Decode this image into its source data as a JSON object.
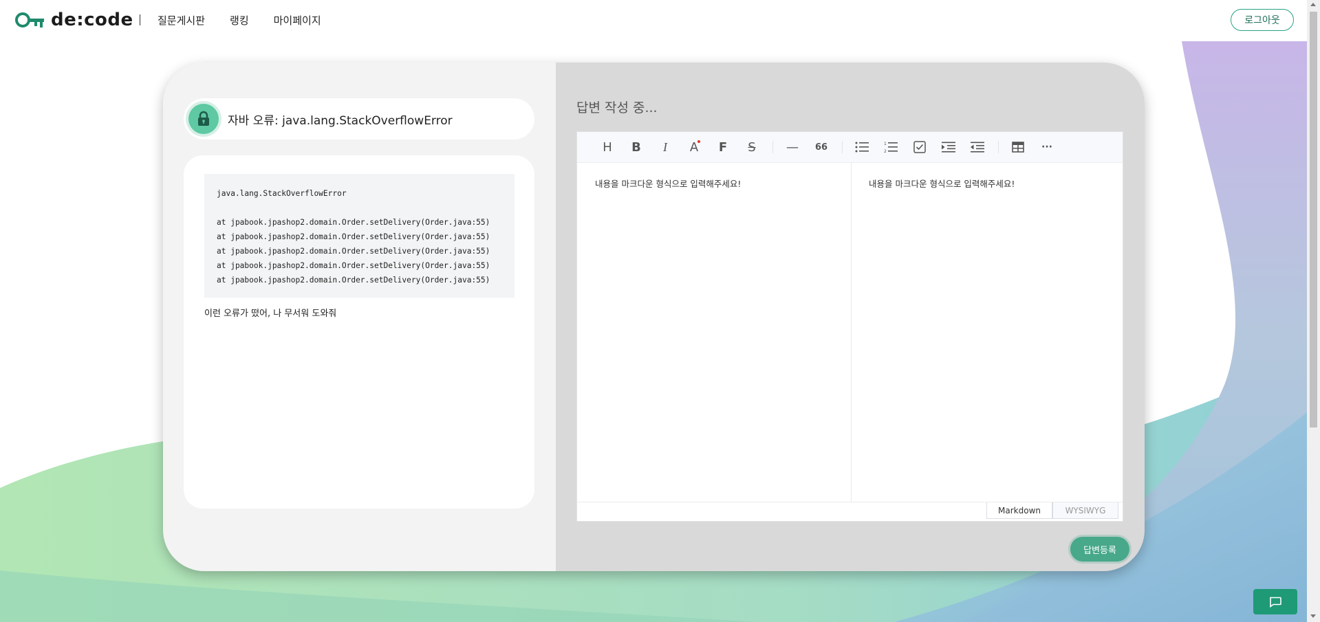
{
  "header": {
    "logo_text": "de:code",
    "nav": [
      "질문게시판",
      "랭킹",
      "마이페이지"
    ],
    "logout_label": "로그아웃"
  },
  "question": {
    "title": "자바 오류: java.lang.StackOverflowError",
    "code_lines": [
      "java.lang.StackOverflowError",
      "",
      "at jpabook.jpashop2.domain.Order.setDelivery(Order.java:55)",
      "at jpabook.jpashop2.domain.Order.setDelivery(Order.java:55)",
      "at jpabook.jpashop2.domain.Order.setDelivery(Order.java:55)",
      "at jpabook.jpashop2.domain.Order.setDelivery(Order.java:55)",
      "at jpabook.jpashop2.domain.Order.setDelivery(Order.java:55)"
    ],
    "text": "이런 오류가 떴어, 나 무서워 도와줘"
  },
  "answer": {
    "heading": "답변 작성 중...",
    "toolbar": {
      "heading": "H",
      "bold": "B",
      "italic": "I",
      "color": "A",
      "font": "F",
      "strike": "S",
      "hr": "—",
      "quote": "66",
      "more": "···"
    },
    "placeholder_markdown": "내용을 마크다운 형식으로 입력해주세요!",
    "placeholder_preview": "내용을 마크다운 형식으로 입력해주세요!",
    "mode_markdown": "Markdown",
    "mode_wysiwyg": "WYSIWYG",
    "submit_label": "답변등록"
  },
  "colors": {
    "accent": "#47a88a",
    "brand": "#27a182",
    "panel_left": "#f3f3f3",
    "panel_right": "#d9d9d9"
  }
}
